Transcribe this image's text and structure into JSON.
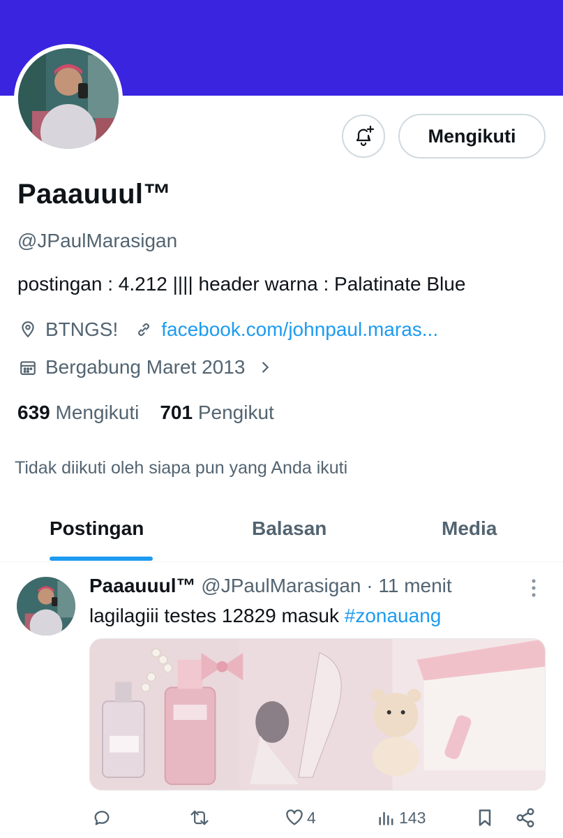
{
  "profile": {
    "display_name": "Paaauuul™",
    "handle": "@JPaulMarasigan",
    "bio": "postingan : 4.212  |||| header warna : Palatinate Blue",
    "location": "BTNGS!",
    "website": "facebook.com/johnpaul.maras...",
    "joined": "Bergabung Maret 2013",
    "following_count": "639",
    "following_label": "Mengikuti",
    "followers_count": "701",
    "followers_label": "Pengikut",
    "not_followed_note": "Tidak diikuti oleh siapa pun yang Anda ikuti"
  },
  "buttons": {
    "follow_label": "Mengikuti"
  },
  "tabs": [
    {
      "label": "Postingan",
      "active": true
    },
    {
      "label": "Balasan",
      "active": false
    },
    {
      "label": "Media",
      "active": false
    }
  ],
  "post": {
    "author_name": "Paaauuul™",
    "author_handle": "@JPaulMarasigan",
    "time": "· 11 menit",
    "text": "lagilagiii testes 12829 masuk ",
    "hashtag": "#zonauang",
    "likes": "4",
    "views": "143"
  },
  "colors": {
    "banner": "#3a24e0",
    "accent": "#1d9bf0",
    "muted": "#536471"
  },
  "icons": [
    "bell-plus-icon",
    "location-pin-icon",
    "link-icon",
    "calendar-icon",
    "chevron-right-icon",
    "more-vertical-icon",
    "reply-icon",
    "repost-icon",
    "like-icon",
    "views-icon",
    "bookmark-icon",
    "share-icon"
  ]
}
